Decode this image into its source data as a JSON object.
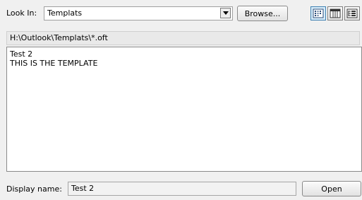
{
  "look_in": {
    "label": "Look In:",
    "value": "Templats",
    "browse_label": "Browse..."
  },
  "view_buttons": [
    {
      "icon": "list-view-icon",
      "pressed": true
    },
    {
      "icon": "details-view-icon",
      "pressed": false
    },
    {
      "icon": "tree-view-icon",
      "pressed": false
    }
  ],
  "path": "H:\\Outlook\\Templats\\*.oft",
  "preview": {
    "lines": [
      "Test 2",
      "THIS IS THE TEMPLATE"
    ]
  },
  "display_name": {
    "label": "Display name:",
    "value": "Test 2"
  },
  "open_label": "Open"
}
